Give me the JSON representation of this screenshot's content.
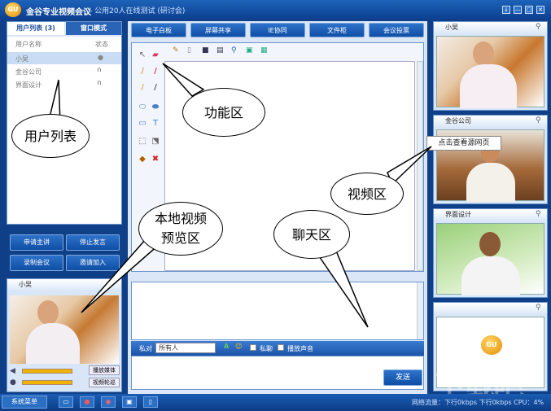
{
  "app": {
    "logo": "GU",
    "title": "金谷专业视频会议",
    "subtitle": "- 公用20人在线测试 (研讨会)"
  },
  "window_controls": [
    "↓",
    "—",
    "□",
    "✕"
  ],
  "user_panel": {
    "tabs": [
      "用户列表 (3)",
      "窗口模式"
    ],
    "col_name": "用户名称",
    "col_status": "状态",
    "users": [
      {
        "name": "小吴",
        "status_icon": "mic-icon"
      },
      {
        "name": "金谷公司",
        "status_icon": "headset-icon"
      },
      {
        "name": "界面设计",
        "status_icon": "headset-icon"
      }
    ]
  },
  "action_buttons": [
    "申请主讲",
    "停止发言",
    "录制会议",
    "邀请加入"
  ],
  "local_video": {
    "name": "小吴",
    "play_media": "播放媒体",
    "video_rotate": "视频轮巡"
  },
  "menu": [
    "电子白板",
    "屏幕共享",
    "IE协同",
    "文件柜",
    "会议投票"
  ],
  "chat": {
    "to_label": "私对",
    "target": "所有人",
    "private": "私聊",
    "play_sound": "播放声音",
    "send": "发送"
  },
  "videos": [
    "小吴",
    "金谷公司",
    "界面设计",
    ""
  ],
  "tooltip": "点击查看源网页",
  "callouts": {
    "user_list": "用户列表",
    "function": "功能区",
    "video": "视频区",
    "local_preview_1": "本地视频",
    "local_preview_2": "预览区",
    "chat": "聊天区"
  },
  "status": {
    "system_menu": "系统菜单",
    "traffic": "网络流量：下行0kbps 下行0kbps CPU：4%"
  },
  "watermark": "下载吧"
}
